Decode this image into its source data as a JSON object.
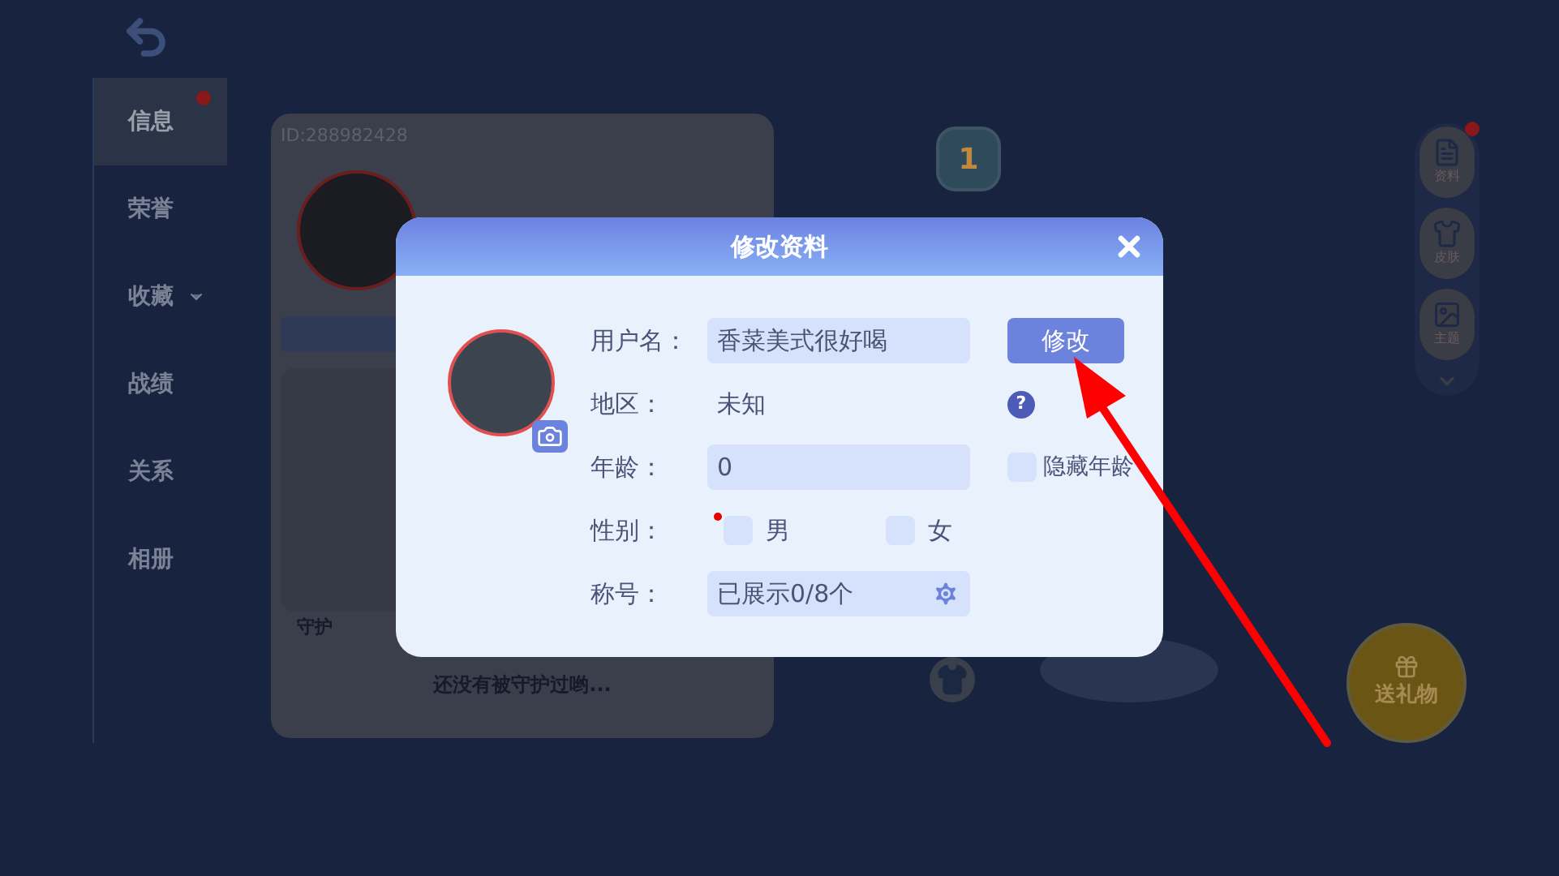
{
  "sidebar": {
    "items": [
      {
        "label": "信息",
        "selected": true,
        "alert": true,
        "expandable": false
      },
      {
        "label": "荣誉",
        "selected": false,
        "alert": false,
        "expandable": false
      },
      {
        "label": "收藏",
        "selected": false,
        "alert": false,
        "expandable": true
      },
      {
        "label": "战绩",
        "selected": false,
        "alert": false,
        "expandable": false
      },
      {
        "label": "关系",
        "selected": false,
        "alert": false,
        "expandable": false
      },
      {
        "label": "相册",
        "selected": false,
        "alert": false,
        "expandable": false
      }
    ]
  },
  "profile_card": {
    "id": "ID:288982428",
    "guard_label": "守护",
    "empty_text": "还没有被守护过哟..."
  },
  "rank_badge": "1",
  "side_actions": [
    {
      "label": "资料",
      "alert": true
    },
    {
      "label": "皮肤",
      "alert": false
    },
    {
      "label": "主题",
      "alert": false
    }
  ],
  "gift_button": "送礼物",
  "dialog": {
    "title": "修改资料",
    "fields": [
      {
        "kind": "input",
        "label": "用户名：",
        "value": "香菜美式很好喝",
        "action": "修改"
      },
      {
        "kind": "text",
        "label": "地区：",
        "value": "未知",
        "help": "?"
      },
      {
        "kind": "input",
        "label": "年龄：",
        "value": "0",
        "option": {
          "label": "隐藏年龄",
          "checked": false
        }
      },
      {
        "kind": "choice",
        "label": "性别：",
        "options": [
          {
            "label": "男",
            "selected": false,
            "marked": true
          },
          {
            "label": "女",
            "selected": false,
            "marked": false
          }
        ]
      },
      {
        "kind": "select",
        "label": "称号：",
        "value": "已展示0/8个"
      }
    ]
  }
}
